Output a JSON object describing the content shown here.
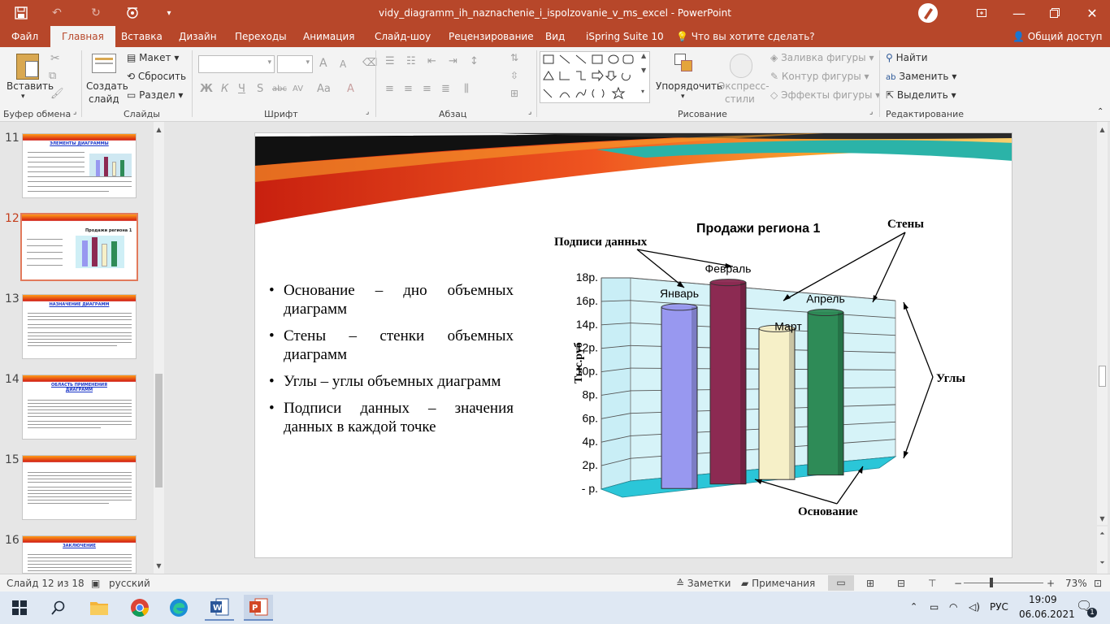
{
  "app": {
    "title": "vidy_diagramm_ih_naznachenie_i_ispolzovanie_v_ms_excel - PowerPoint",
    "save_icon": "save-icon",
    "accent": "#b7472a"
  },
  "tabs": [
    "Файл",
    "Главная",
    "Вставка",
    "Дизайн",
    "Переходы",
    "Анимация",
    "Слайд-шоу",
    "Рецензирование",
    "Вид",
    "iSpring Suite 10"
  ],
  "active_tab": "Главная",
  "tellme": "Что вы хотите сделать?",
  "share": "Общий доступ",
  "ribbon": {
    "clipboard": {
      "paste": "Вставить",
      "label": "Буфер обмена"
    },
    "slides": {
      "new_line1": "Создать",
      "new_line2": "слайд",
      "layout": "Макет",
      "reset": "Сбросить",
      "section": "Раздел",
      "label": "Слайды"
    },
    "font": {
      "bold": "Ж",
      "italic": "К",
      "underline": "Ч",
      "shadow": "S",
      "strike": "abc",
      "spacing": "AV",
      "case": "Aa",
      "grow": "A",
      "shrink": "A",
      "label": "Шрифт"
    },
    "paragraph": {
      "label": "Абзац"
    },
    "drawing": {
      "arrange": "Упорядочить",
      "styles_line1": "Экспресс-",
      "styles_line2": "стили",
      "fill": "Заливка фигуры",
      "outline": "Контур фигуры",
      "effects": "Эффекты фигуры",
      "label": "Рисование"
    },
    "editing": {
      "find": "Найти",
      "replace": "Заменить",
      "select": "Выделить",
      "label": "Редактирование"
    }
  },
  "thumbnails": [
    {
      "num": "11",
      "title": "ЭЛЕМЕНТЫ ДИАГРАММЫ"
    },
    {
      "num": "12",
      "title": "Продажи региона 1"
    },
    {
      "num": "13",
      "title": "НАЗНАЧЕНИЕ ДИАГРАММ"
    },
    {
      "num": "14",
      "title": "ОБЛАСТЬ ПРИМЕНЕНИЯ ДИАГРАММ"
    },
    {
      "num": "15",
      "title": ""
    },
    {
      "num": "16",
      "title": "ЗАКЛЮЧЕНИЕ"
    }
  ],
  "selected_slide": "12",
  "slide": {
    "bullets": [
      "Основание – дно объемных диаграмм",
      "Стены – стенки объемных диаграмм",
      "Углы – углы объемных диаграмм",
      "Подписи данных – значения данных в каждой точке"
    ]
  },
  "chart_data": {
    "type": "bar",
    "title": "Продажи региона 1",
    "ylabel": "Тыс.руб",
    "yticks": [
      "- р.",
      "2р.",
      "4р.",
      "6р.",
      "8р.",
      "10р.",
      "12р.",
      "14р.",
      "16р.",
      "18р."
    ],
    "ylim": [
      0,
      18
    ],
    "categories": [
      "Январь",
      "Февраль",
      "Март",
      "Апрель"
    ],
    "values": [
      15,
      17,
      13,
      14.3
    ],
    "colors": [
      "#9898f0",
      "#8c2a52",
      "#f6f0c8",
      "#2e8b57"
    ],
    "annotations": [
      "Подписи данных",
      "Стены",
      "Углы",
      "Основание"
    ],
    "grid": true
  },
  "status": {
    "slide_info": "Слайд 12 из 18",
    "language": "русский",
    "notes": "Заметки",
    "comments": "Примечания",
    "zoom": "73%",
    "zoom_minus": "−",
    "zoom_plus": "+"
  },
  "taskbar": {
    "lang": "РУС",
    "time": "19:09",
    "date": "06.06.2021",
    "notify_count": "1"
  }
}
